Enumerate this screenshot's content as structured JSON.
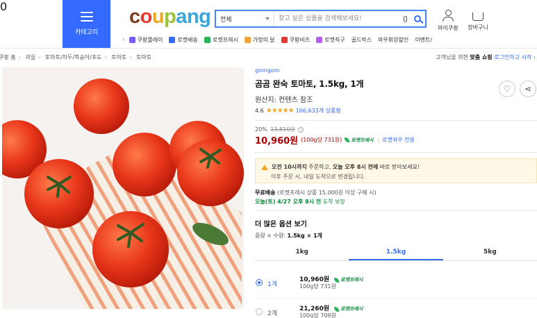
{
  "header": {
    "category_label": "카테고리",
    "logo": [
      "c",
      "o",
      "u",
      "p",
      "a",
      "n",
      "g"
    ],
    "search": {
      "scope": "전체",
      "placeholder": "찾고 싶은 상품을 검색해보세요!"
    },
    "mypage_label": "마이쿠팡",
    "cart_label": "장바구니",
    "cart_count": "0",
    "quicknav": [
      {
        "label": "쿠팡플레이",
        "color": "#7a5cff"
      },
      {
        "label": "로켓배송",
        "color": "#346aff"
      },
      {
        "label": "로켓프레시",
        "color": "#2cb35a"
      },
      {
        "label": "가정의 달",
        "color": "#f0a43a"
      },
      {
        "label": "쿠팡비즈",
        "color": "#e53b2f"
      },
      {
        "label": "로켓직구",
        "color": "#b85cf5"
      },
      {
        "label": "골드박스",
        "color": "#ffffff"
      },
      {
        "label": "와우회원할인",
        "color": "#ffffff"
      },
      {
        "label": "이벤트/",
        "color": "#ffffff"
      }
    ]
  },
  "breadcrumb": [
    "쿠팡 홈",
    "과일",
    "토마토/자두/복숭아/포도",
    "토마토",
    "토마토"
  ],
  "promo": {
    "prefix": "고객님을 위한",
    "bold": "맞춤 쇼핑",
    "login": "로그인하고 시작 ›"
  },
  "product": {
    "brand": "gomgom",
    "title": "곰곰 완숙 토마토, 1.5kg, 1개",
    "origin": "원산지: 컨텐츠 참조",
    "rating": "4.6",
    "stars": "★★★★★",
    "reviews": "166,633개 상품평",
    "discount": "20%",
    "original_price": "13,810원",
    "price": "10,960원",
    "unit_price": "(100g당 731원)",
    "badge": "로켓프레시",
    "wow": "로켓와우 전용"
  },
  "notice": {
    "line1_a": "오전 10시까지",
    "line1_b": " 주문하고, ",
    "line1_c": "오늘 오후 8시 전에",
    "line1_d": " 바로 받아보세요!",
    "line2": "이후 주문 시, 내일 도착으로 변경됩니다."
  },
  "delivery": {
    "label": "무료배송",
    "detail": " (로켓프레시 상품 15,000원 이상 구매 시)",
    "arrive_bold": "오늘(토) 4/27 오후 8시 전",
    "arrive_rest": " 도착 보장"
  },
  "options": {
    "title": "더 많은 옵션 보기",
    "summary_prefix": "중량 × 수량: ",
    "summary_value": "1.5kg × 1개",
    "tabs": [
      "1kg",
      "1.5kg",
      "5kg"
    ],
    "active_tab": "1.5kg",
    "rows": [
      {
        "qty": "1개",
        "price": "10,960원",
        "badge": "로켓프레시",
        "unit": "100g당 731원",
        "selected": true
      },
      {
        "qty": "2개",
        "price": "21,260원",
        "badge": "로켓프레시",
        "unit": "100g당 709원",
        "selected": false
      }
    ]
  }
}
